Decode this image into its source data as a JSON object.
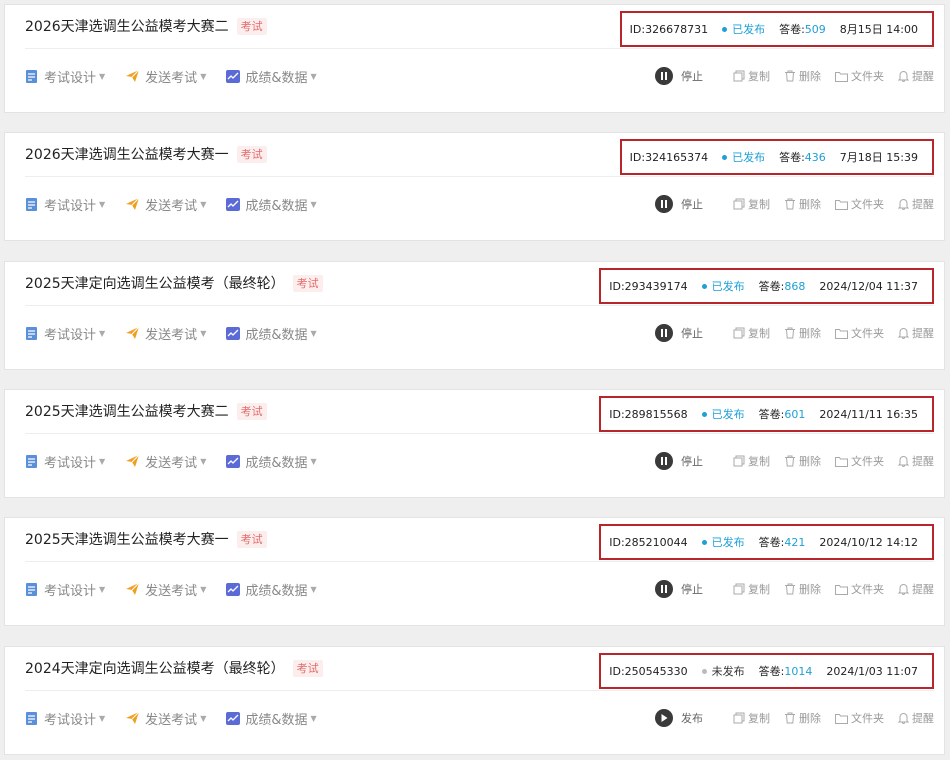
{
  "colors": {
    "accent": "#1e9fd6",
    "highlight_box": "#b8262b",
    "tag_text": "#e36b6b",
    "tag_bg": "#fdeeee"
  },
  "labels": {
    "design": "考试设计",
    "send": "发送考试",
    "results": "成绩&数据",
    "copy": "复制",
    "delete": "删除",
    "folder": "文件夹",
    "remind": "提醒",
    "answers_prefix": "答卷:"
  },
  "icons": {
    "design": "document-edit-icon",
    "send": "paper-plane-icon",
    "results": "chart-icon",
    "pause": "pause-icon",
    "publish": "play-icon",
    "copy": "copy-icon",
    "delete": "trash-icon",
    "folder": "folder-icon",
    "remind": "bell-icon",
    "caret": "caret-down-icon"
  },
  "surveys": [
    {
      "title": "2026天津选调生公益模考大赛二",
      "tag": "考试",
      "id": "ID:326678731",
      "status": "已发布",
      "published": true,
      "answers": "509",
      "date": "8月15日 14:00",
      "primary_action": "停止"
    },
    {
      "title": "2026天津选调生公益模考大赛一",
      "tag": "考试",
      "id": "ID:324165374",
      "status": "已发布",
      "published": true,
      "answers": "436",
      "date": "7月18日 15:39",
      "primary_action": "停止"
    },
    {
      "title": "2025天津定向选调生公益模考（最终轮）",
      "tag": "考试",
      "id": "ID:293439174",
      "status": "已发布",
      "published": true,
      "answers": "868",
      "date": "2024/12/04 11:37",
      "primary_action": "停止"
    },
    {
      "title": "2025天津选调生公益模考大赛二",
      "tag": "考试",
      "id": "ID:289815568",
      "status": "已发布",
      "published": true,
      "answers": "601",
      "date": "2024/11/11 16:35",
      "primary_action": "停止"
    },
    {
      "title": "2025天津选调生公益模考大赛一",
      "tag": "考试",
      "id": "ID:285210044",
      "status": "已发布",
      "published": true,
      "answers": "421",
      "date": "2024/10/12 14:12",
      "primary_action": "停止"
    },
    {
      "title": "2024天津定向选调生公益模考（最终轮）",
      "tag": "考试",
      "id": "ID:250545330",
      "status": "未发布",
      "published": false,
      "answers": "1014",
      "date": "2024/1/03 11:07",
      "primary_action": "发布"
    }
  ]
}
